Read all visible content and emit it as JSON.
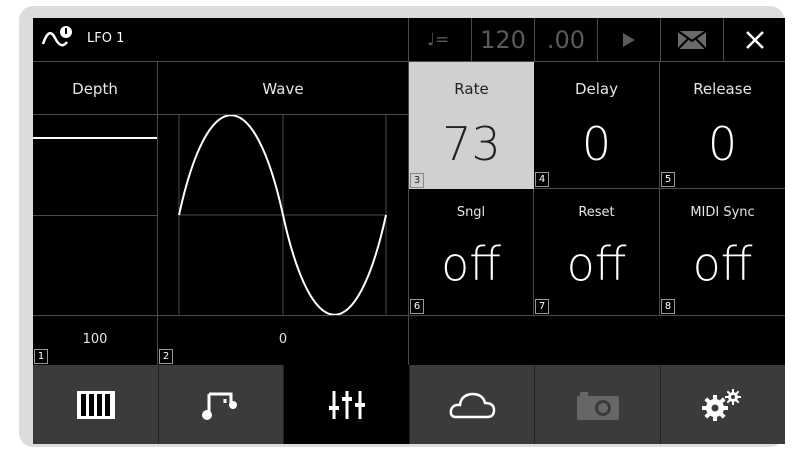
{
  "header": {
    "title": "LFO 1",
    "tempo": "120",
    "tempo_frac": ".00"
  },
  "params": {
    "depth": {
      "label": "Depth",
      "value": "100",
      "index": "1"
    },
    "wave": {
      "label": "Wave",
      "value": "0",
      "index": "2"
    },
    "rate": {
      "label": "Rate",
      "value": "73",
      "index": "3"
    },
    "delay": {
      "label": "Delay",
      "value": "0",
      "index": "4"
    },
    "release": {
      "label": "Release",
      "value": "0",
      "index": "5"
    },
    "sngl": {
      "label": "Sngl",
      "value": "off",
      "index": "6"
    },
    "reset": {
      "label": "Reset",
      "value": "off",
      "index": "7"
    },
    "midisync": {
      "label": "MIDI Sync",
      "value": "off",
      "index": "8"
    }
  },
  "nav": [
    "piano-icon",
    "notes-icon",
    "mixer-sliders-icon",
    "cloud-icon",
    "camera-icon",
    "gears-icon"
  ],
  "colors": {
    "selected_bg": "#d0d0d0",
    "nav_bg": "#3b3b3b",
    "background": "#000000"
  }
}
